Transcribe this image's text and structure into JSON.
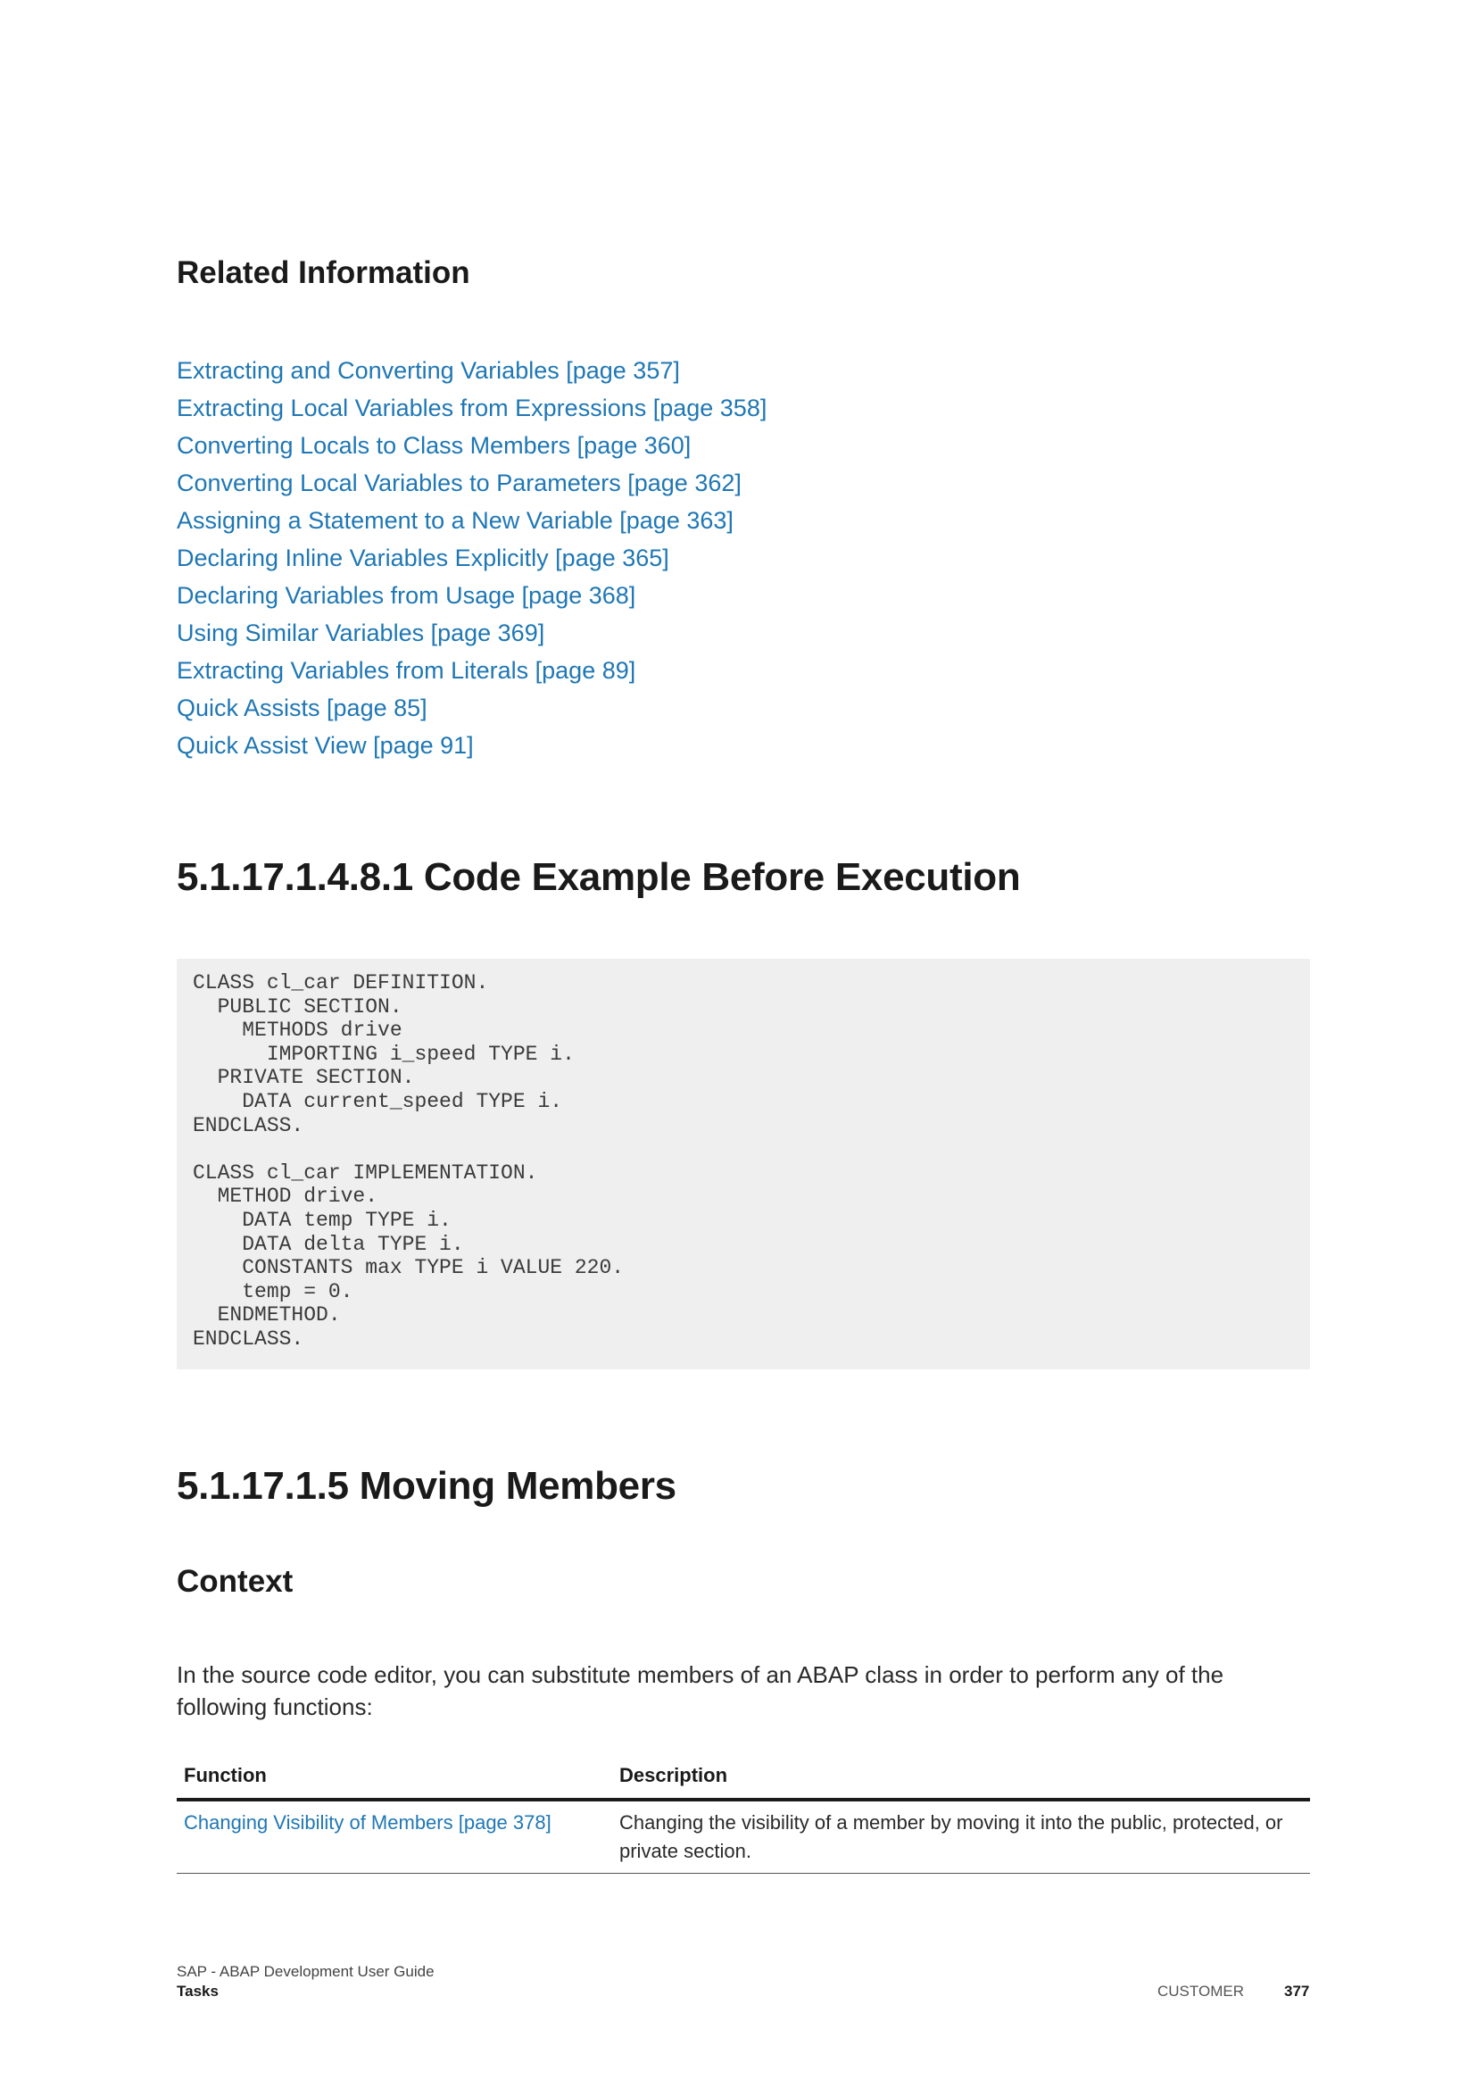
{
  "related": {
    "heading": "Related Information",
    "links": [
      "Extracting and Converting Variables [page 357]",
      "Extracting Local Variables from Expressions [page 358]",
      "Converting Locals to Class Members [page 360]",
      "Converting Local Variables to Parameters [page 362]",
      "Assigning a Statement to a New Variable [page 363]",
      "Declaring Inline Variables Explicitly [page 365]",
      "Declaring Variables from Usage [page 368]",
      "Using Similar Variables [page 369]",
      "Extracting Variables from Literals [page 89]",
      "Quick Assists [page 85]",
      "Quick Assist View [page 91]"
    ]
  },
  "code_section": {
    "heading": "5.1.17.1.4.8.1  Code Example Before Execution",
    "code": "CLASS cl_car DEFINITION.\n  PUBLIC SECTION.\n    METHODS drive\n      IMPORTING i_speed TYPE i.\n  PRIVATE SECTION.\n    DATA current_speed TYPE i.\nENDCLASS.\n\nCLASS cl_car IMPLEMENTATION.\n  METHOD drive.\n    DATA temp TYPE i.\n    DATA delta TYPE i.\n    CONSTANTS max TYPE i VALUE 220.\n    temp = 0.\n  ENDMETHOD.\nENDCLASS."
  },
  "moving_section": {
    "heading": "5.1.17.1.5  Moving Members",
    "context_heading": "Context",
    "context_text": "In the source code editor, you can substitute members of an ABAP class in order to perform any of the following functions:",
    "table": {
      "headers": [
        "Function",
        "Description"
      ],
      "rows": [
        {
          "function": "Changing Visibility of Members [page 378]",
          "description": "Changing the visibility of a member by moving it into the public, protected, or private section."
        }
      ]
    }
  },
  "footer": {
    "doc_title": "SAP - ABAP Development User Guide",
    "chapter": "Tasks",
    "classification": "CUSTOMER",
    "page_number": "377"
  }
}
